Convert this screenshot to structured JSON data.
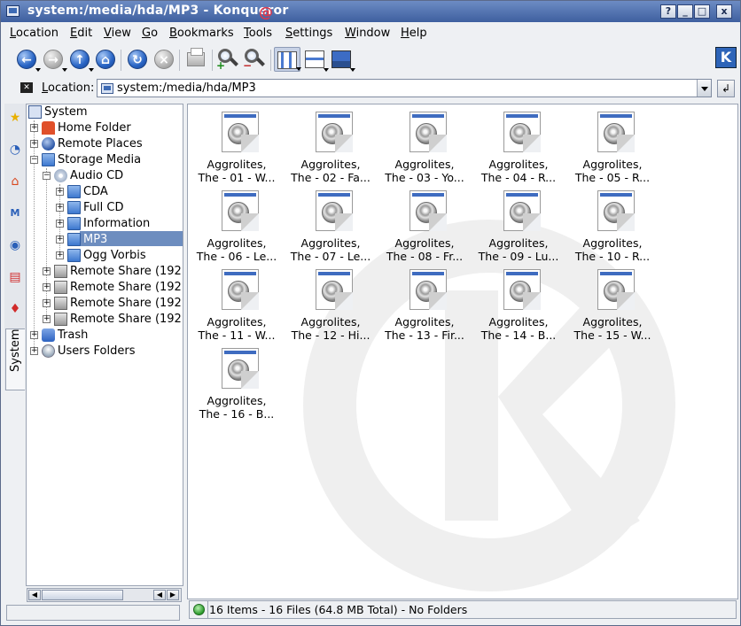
{
  "window": {
    "title": "system:/media/hda/MP3 - Konqueror",
    "controls": [
      "?",
      "_",
      "□",
      "x"
    ]
  },
  "menubar": [
    "Location",
    "Edit",
    "View",
    "Go",
    "Bookmarks",
    "Tools",
    "Settings",
    "Window",
    "Help"
  ],
  "toolbar": {
    "buttons": [
      "back-icon",
      "forward-icon",
      "up-icon",
      "home-icon",
      "reload-icon",
      "stop-icon",
      "print-icon",
      "zoom-in-icon",
      "zoom-out-icon",
      "icon-view-icon",
      "tree-view-icon",
      "image-view-icon"
    ],
    "active_view": "icon-view"
  },
  "location": {
    "label": "Location:",
    "value": "system:/media/hda/MP3"
  },
  "sidebar": {
    "tabs": [
      "bookmarks-icon",
      "history-icon",
      "home-icon",
      "services-icon",
      "network-icon",
      "root-folder-icon",
      "media-icon"
    ],
    "active_tab": "System"
  },
  "tree": {
    "items": [
      {
        "label": "System",
        "level": 0,
        "expander": "",
        "icon": "system"
      },
      {
        "label": "Home Folder",
        "level": 1,
        "expander": "+",
        "icon": "home"
      },
      {
        "label": "Remote Places",
        "level": 1,
        "expander": "+",
        "icon": "remote"
      },
      {
        "label": "Storage Media",
        "level": 1,
        "expander": "−",
        "icon": "folder"
      },
      {
        "label": "Audio CD",
        "level": 2,
        "expander": "−",
        "icon": "cd"
      },
      {
        "label": "CDA",
        "level": 3,
        "expander": "+",
        "icon": "folder"
      },
      {
        "label": "Full CD",
        "level": 3,
        "expander": "+",
        "icon": "folder"
      },
      {
        "label": "Information",
        "level": 3,
        "expander": "+",
        "icon": "folder"
      },
      {
        "label": "MP3",
        "level": 3,
        "expander": "+",
        "icon": "folder",
        "selected": true
      },
      {
        "label": "Ogg Vorbis",
        "level": 3,
        "expander": "+",
        "icon": "folder"
      },
      {
        "label": "Remote Share (192.",
        "level": 2,
        "expander": "+",
        "icon": "net"
      },
      {
        "label": "Remote Share (192.",
        "level": 2,
        "expander": "+",
        "icon": "net"
      },
      {
        "label": "Remote Share (192.",
        "level": 2,
        "expander": "+",
        "icon": "net"
      },
      {
        "label": "Remote Share (192.",
        "level": 2,
        "expander": "+",
        "icon": "net"
      },
      {
        "label": "Trash",
        "level": 1,
        "expander": "+",
        "icon": "trash"
      },
      {
        "label": "Users Folders",
        "level": 1,
        "expander": "+",
        "icon": "users"
      }
    ]
  },
  "files": [
    {
      "line1": "Aggrolites,",
      "line2": "The - 01 - W..."
    },
    {
      "line1": "Aggrolites,",
      "line2": "The - 02 - Fa..."
    },
    {
      "line1": "Aggrolites,",
      "line2": "The - 03 - Yo..."
    },
    {
      "line1": "Aggrolites,",
      "line2": "The - 04 - R..."
    },
    {
      "line1": "Aggrolites,",
      "line2": "The - 05 - R..."
    },
    {
      "line1": "Aggrolites,",
      "line2": "The - 06 - Le..."
    },
    {
      "line1": "Aggrolites,",
      "line2": "The - 07 - Le..."
    },
    {
      "line1": "Aggrolites,",
      "line2": "The - 08 - Fr..."
    },
    {
      "line1": "Aggrolites,",
      "line2": "The - 09 - Lu..."
    },
    {
      "line1": "Aggrolites,",
      "line2": "The - 10 - R..."
    },
    {
      "line1": "Aggrolites,",
      "line2": "The - 11 - W..."
    },
    {
      "line1": "Aggrolites,",
      "line2": "The - 12 - Hi..."
    },
    {
      "line1": "Aggrolites,",
      "line2": "The - 13 - Fir..."
    },
    {
      "line1": "Aggrolites,",
      "line2": "The - 14 - B..."
    },
    {
      "line1": "Aggrolites,",
      "line2": "The - 15 - W..."
    },
    {
      "line1": "Aggrolites,",
      "line2": "The - 16 - B..."
    }
  ],
  "status": {
    "text": "16 Items - 16 Files (64.8 MB Total) - No Folders"
  },
  "colors": {
    "titlebar": "#3e5f9f",
    "selection": "#6d8dbf",
    "window_bg": "#eef0f3"
  }
}
